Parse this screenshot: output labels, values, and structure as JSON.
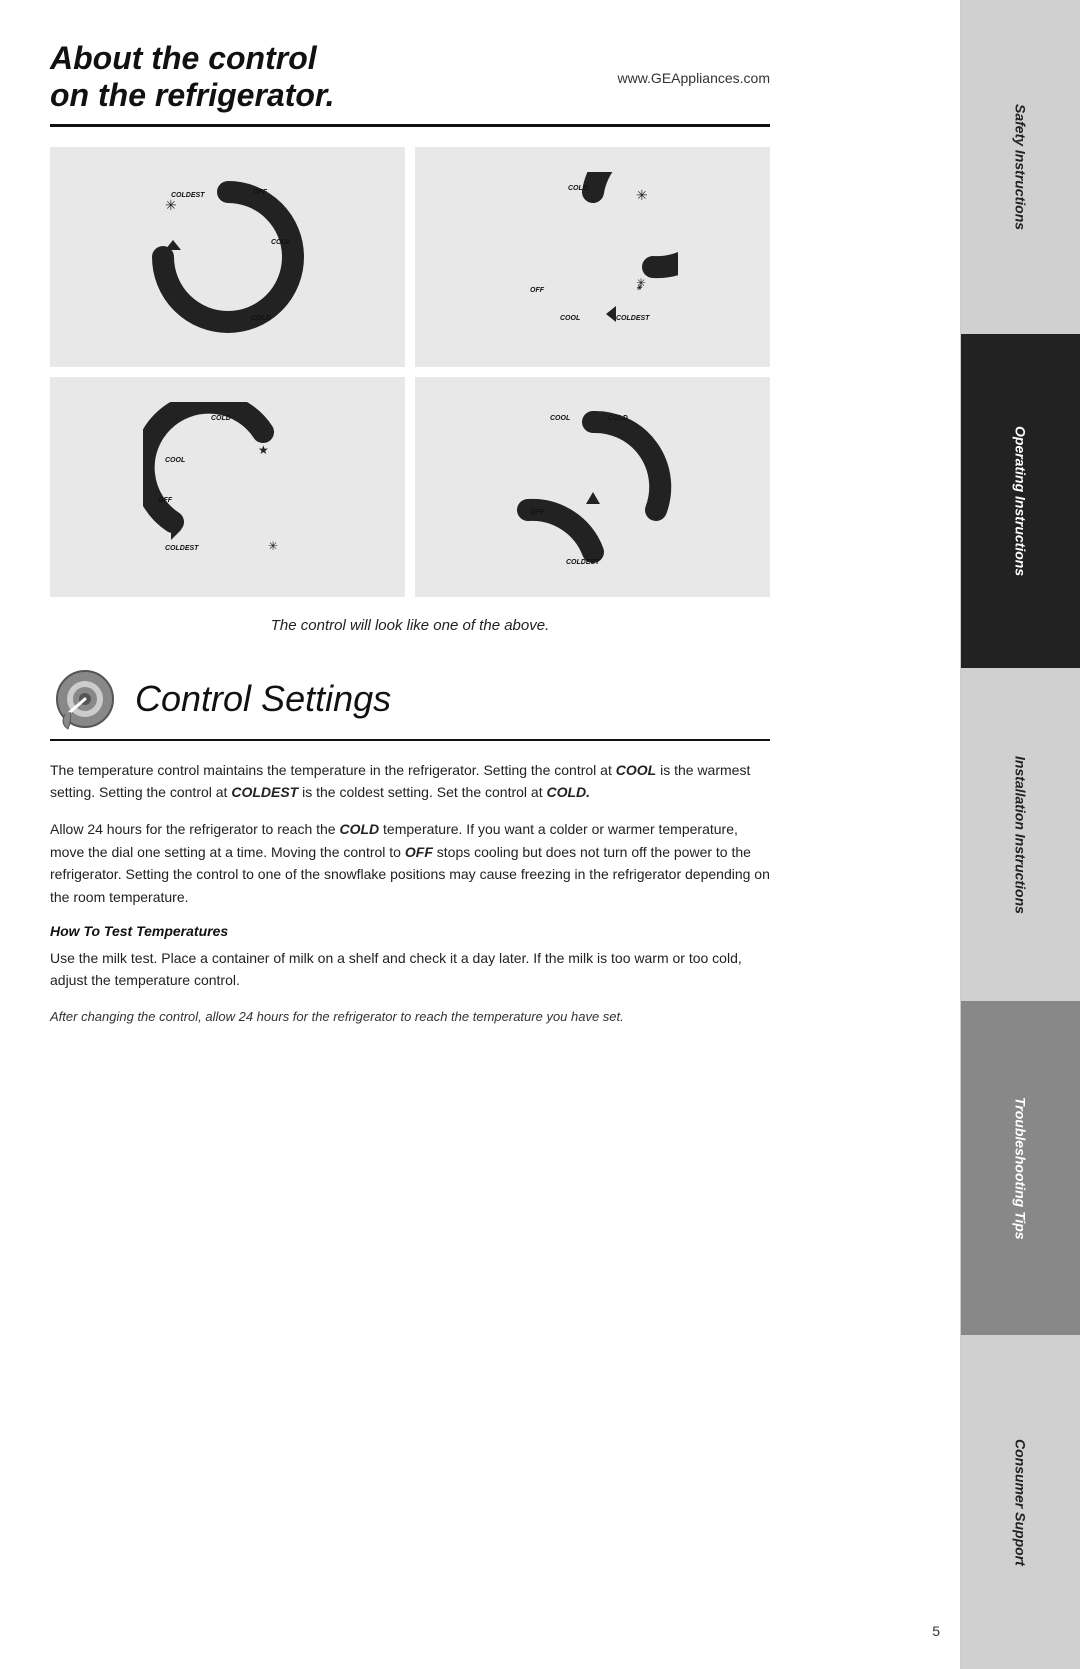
{
  "header": {
    "title_line1": "About the control",
    "title_line2": "on the refrigerator.",
    "website": "www.GEAppliances.com"
  },
  "caption": {
    "text": "The control will look like one of the above."
  },
  "section_title": "Control Settings",
  "paragraphs": [
    {
      "text": "The temperature control maintains the temperature in the refrigerator. Setting the control at COOL is the warmest setting. Setting the control at COLDEST is the coldest setting. Set the control at COLD."
    },
    {
      "text": "Allow 24 hours for the refrigerator to reach the COLD temperature. If you want a colder or warmer temperature, move the dial one setting at a time. Moving the control to OFF stops cooling but does not turn off the power to the refrigerator. Setting the control to one of the snowflake positions may cause freezing in the refrigerator depending on the room temperature."
    }
  ],
  "how_to": {
    "title": "How To Test Temperatures",
    "text": "Use the milk test. Place a container of milk on a shelf and check it a day later. If the milk is too warm or too cold, adjust the temperature control."
  },
  "italic_note": "After changing the control, allow 24 hours for the refrigerator to reach the temperature you have set.",
  "sidebar": {
    "sections": [
      "Safety Instructions",
      "Operating Instructions",
      "Installation Instructions",
      "Troubleshooting Tips",
      "Consumer Support"
    ]
  },
  "page_number": "5",
  "dials": [
    {
      "labels": [
        "COLDEST",
        "OFF",
        "COOL",
        "COLD"
      ],
      "variant": "top-left"
    },
    {
      "labels": [
        "COLD",
        "COOL",
        "OFF",
        "COLDEST"
      ],
      "variant": "top-right"
    },
    {
      "labels": [
        "COLD",
        "COOL",
        "OFF",
        "COLDEST"
      ],
      "variant": "bottom-left"
    },
    {
      "labels": [
        "COOL",
        "COLD",
        "OFF",
        "COLDEST"
      ],
      "variant": "bottom-right"
    }
  ]
}
